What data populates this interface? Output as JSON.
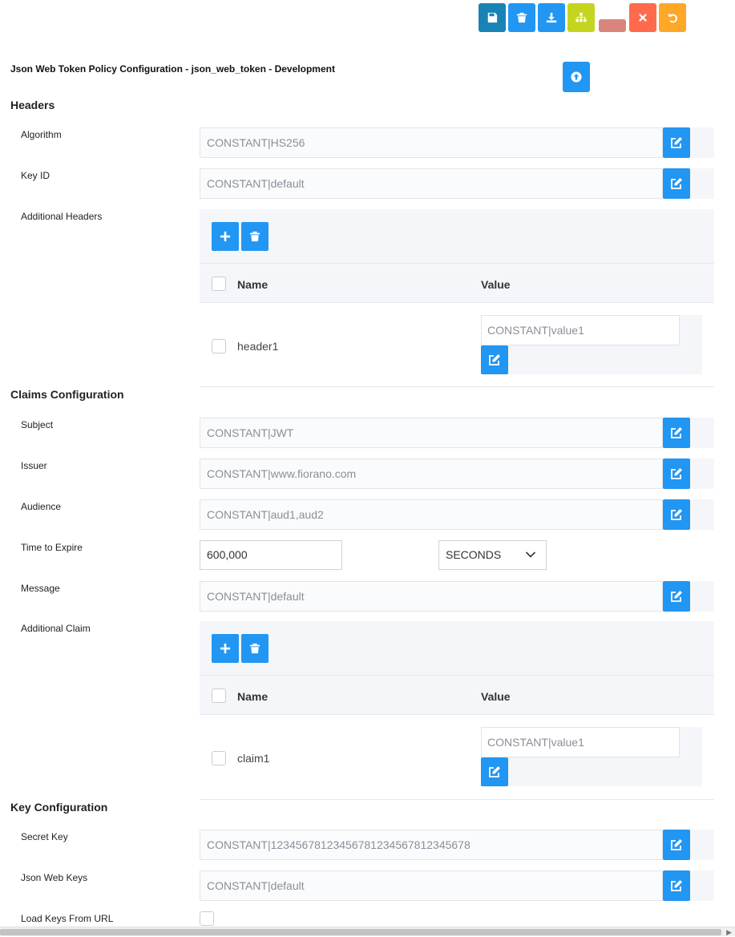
{
  "toolbar": {
    "buttons": [
      {
        "name": "save",
        "icon": "save-icon",
        "color": "#1a83b5"
      },
      {
        "name": "delete",
        "icon": "trash-icon",
        "color": "#2196f3"
      },
      {
        "name": "download",
        "icon": "download-icon",
        "color": "#2196f3"
      },
      {
        "name": "hierarchy",
        "icon": "sitemap-icon",
        "color": "#c5d51f"
      },
      {
        "name": "blank",
        "icon": "",
        "color": "#d9857b"
      },
      {
        "name": "close",
        "icon": "close-icon",
        "color": "#ff6a4d"
      },
      {
        "name": "undo",
        "icon": "undo-icon",
        "color": "#ffa726"
      }
    ]
  },
  "page": {
    "title": "Json Web Token Policy Configuration - json_web_token - Development"
  },
  "headers_section": {
    "title": "Headers",
    "algorithm": {
      "label": "Algorithm",
      "value": "CONSTANT|HS256"
    },
    "key_id": {
      "label": "Key ID",
      "value": "CONSTANT|default"
    },
    "additional_headers": {
      "label": "Additional Headers",
      "col_name": "Name",
      "col_value": "Value",
      "rows": [
        {
          "name": "header1",
          "value": "CONSTANT|value1"
        }
      ]
    }
  },
  "claims_section": {
    "title": "Claims Configuration",
    "subject": {
      "label": "Subject",
      "value": "CONSTANT|JWT"
    },
    "issuer": {
      "label": "Issuer",
      "value": "CONSTANT|www.fiorano.com"
    },
    "audience": {
      "label": "Audience",
      "value": "CONSTANT|aud1,aud2"
    },
    "time_to_expire": {
      "label": "Time to Expire",
      "value": "600,000",
      "unit": "SECONDS"
    },
    "message": {
      "label": "Message",
      "value": "CONSTANT|default"
    },
    "additional_claim": {
      "label": "Additional Claim",
      "col_name": "Name",
      "col_value": "Value",
      "rows": [
        {
          "name": "claim1",
          "value": "CONSTANT|value1"
        }
      ]
    }
  },
  "key_section": {
    "title": "Key Configuration",
    "secret_key": {
      "label": "Secret Key",
      "value": "CONSTANT|12345678123456781234567812345678"
    },
    "json_web_keys": {
      "label": "Json Web Keys",
      "value": "CONSTANT|default"
    },
    "load_keys_from_url": {
      "label": "Load Keys From URL"
    }
  },
  "colors": {
    "accent": "#2196f3",
    "field_bg": "#f5f6fa"
  }
}
